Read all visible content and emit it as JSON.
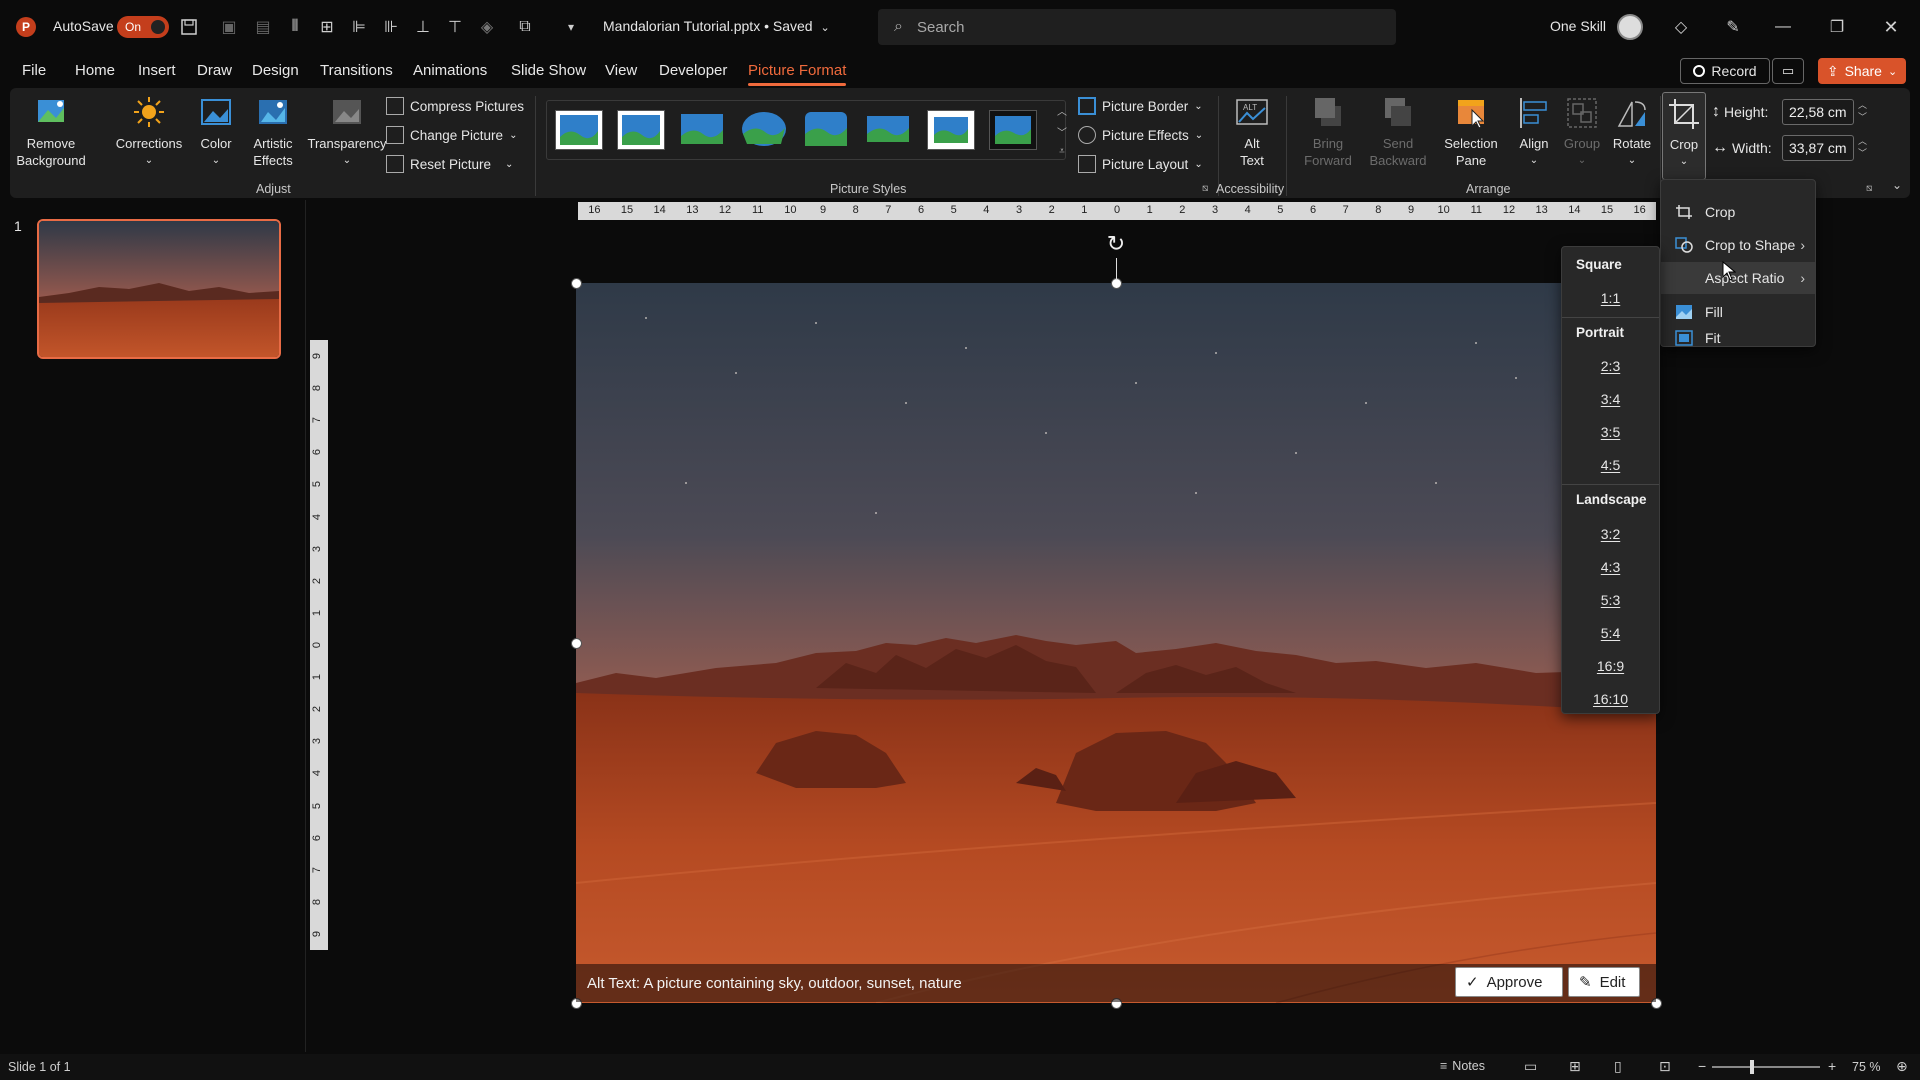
{
  "titlebar": {
    "autosave_label": "AutoSave",
    "autosave_state": "On",
    "document_title": "Mandalorian Tutorial.pptx • Saved",
    "search_placeholder": "Search",
    "user_name": "One Skill"
  },
  "menu": {
    "tabs": [
      "File",
      "Home",
      "Insert",
      "Draw",
      "Design",
      "Transitions",
      "Animations",
      "Slide Show",
      "View",
      "Developer",
      "Picture Format"
    ],
    "active_tab": "Picture Format",
    "record_label": "Record",
    "share_label": "Share"
  },
  "ribbon": {
    "adjust": {
      "remove_background": [
        "Remove",
        "Background"
      ],
      "corrections": "Corrections",
      "color": "Color",
      "artistic_effects": [
        "Artistic",
        "Effects"
      ],
      "transparency": "Transparency",
      "compress": "Compress Pictures",
      "change": "Change Picture",
      "reset": "Reset Picture",
      "group_label": "Adjust"
    },
    "picture_styles": {
      "group_label": "Picture Styles",
      "border": "Picture Border",
      "effects": "Picture Effects",
      "layout": "Picture Layout"
    },
    "accessibility": {
      "alt_text": [
        "Alt",
        "Text"
      ],
      "group_label": "Accessibility"
    },
    "arrange": {
      "bring_forward": [
        "Bring",
        "Forward"
      ],
      "send_backward": [
        "Send",
        "Backward"
      ],
      "selection_pane": [
        "Selection",
        "Pane"
      ],
      "align": "Align",
      "group": "Group",
      "rotate": "Rotate",
      "group_label": "Arrange"
    },
    "size": {
      "crop": "Crop",
      "height_label": "Height:",
      "height_value": "22,58 cm",
      "width_label": "Width:",
      "width_value": "33,87 cm"
    }
  },
  "slides_panel": {
    "slide_number": "1"
  },
  "ruler": {
    "horizontal": [
      "16",
      "15",
      "14",
      "13",
      "12",
      "11",
      "10",
      "9",
      "8",
      "7",
      "6",
      "5",
      "4",
      "3",
      "2",
      "1",
      "0",
      "1",
      "2",
      "3",
      "4",
      "5",
      "6",
      "7",
      "8",
      "9",
      "10",
      "11",
      "12",
      "13",
      "14",
      "15",
      "16"
    ],
    "vertical": [
      "9",
      "8",
      "7",
      "6",
      "5",
      "4",
      "3",
      "2",
      "1",
      "0",
      "1",
      "2",
      "3",
      "4",
      "5",
      "6",
      "7",
      "8",
      "9"
    ]
  },
  "crop_menu": {
    "items": [
      "Crop",
      "Crop to Shape",
      "Aspect Ratio",
      "Fill",
      "Fit"
    ],
    "hovered": "Aspect Ratio"
  },
  "aspect_ratio_menu": {
    "square_label": "Square",
    "square": [
      "1:1"
    ],
    "portrait_label": "Portrait",
    "portrait": [
      "2:3",
      "3:4",
      "3:5",
      "4:5"
    ],
    "landscape_label": "Landscape",
    "landscape": [
      "3:2",
      "4:3",
      "5:3",
      "5:4",
      "16:9",
      "16:10"
    ]
  },
  "alt_text_bar": {
    "text": "Alt Text: A picture containing sky, outdoor, sunset, nature",
    "approve_label": "Approve",
    "edit_label": "Edit"
  },
  "status": {
    "slide_info": "Slide 1 of 1",
    "notes_label": "Notes",
    "zoom_level": "75 %"
  },
  "colors": {
    "accent": "#f06a3c",
    "ribbon_bg": "#1e1e1e",
    "menu_bg": "#282828"
  }
}
